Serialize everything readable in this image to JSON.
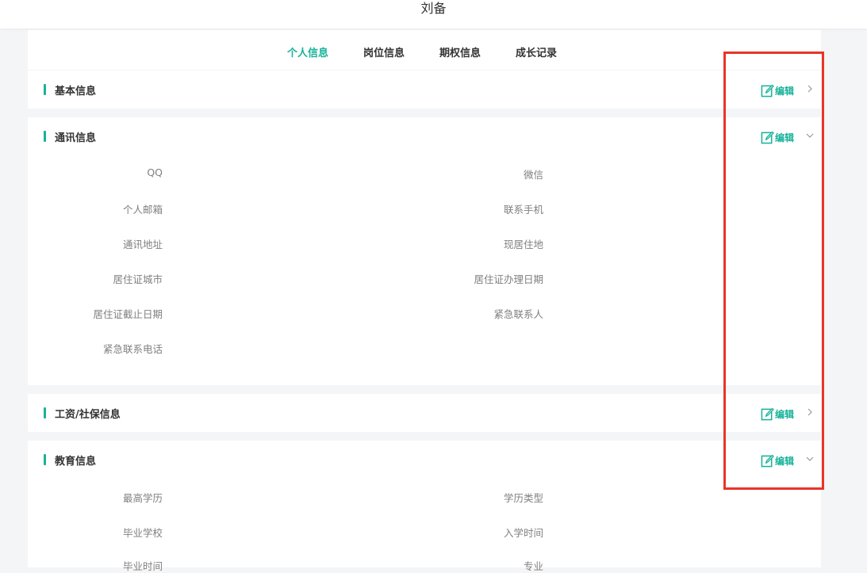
{
  "header": {
    "title": "刘备"
  },
  "tabs": [
    {
      "label": "个人信息",
      "active": true
    },
    {
      "label": "岗位信息",
      "active": false
    },
    {
      "label": "期权信息",
      "active": false
    },
    {
      "label": "成长记录",
      "active": false
    }
  ],
  "edit_label": "编辑",
  "sections": [
    {
      "title": "基本信息",
      "state": "collapsed",
      "fields": []
    },
    {
      "title": "通讯信息",
      "state": "expanded",
      "fields": [
        "QQ",
        "微信",
        "个人邮箱",
        "联系手机",
        "通讯地址",
        "现居住地",
        "居住证城市",
        "居住证办理日期",
        "居住证截止日期",
        "紧急联系人",
        "紧急联系电话"
      ]
    },
    {
      "title": "工资/社保信息",
      "state": "collapsed",
      "fields": []
    },
    {
      "title": "教育信息",
      "state": "expanded",
      "fields": [
        "最高学历",
        "学历类型",
        "毕业学校",
        "入学时间",
        "毕业时间",
        "专业"
      ]
    }
  ],
  "colors": {
    "accent": "#18b29a",
    "highlight": "#e8352a"
  }
}
